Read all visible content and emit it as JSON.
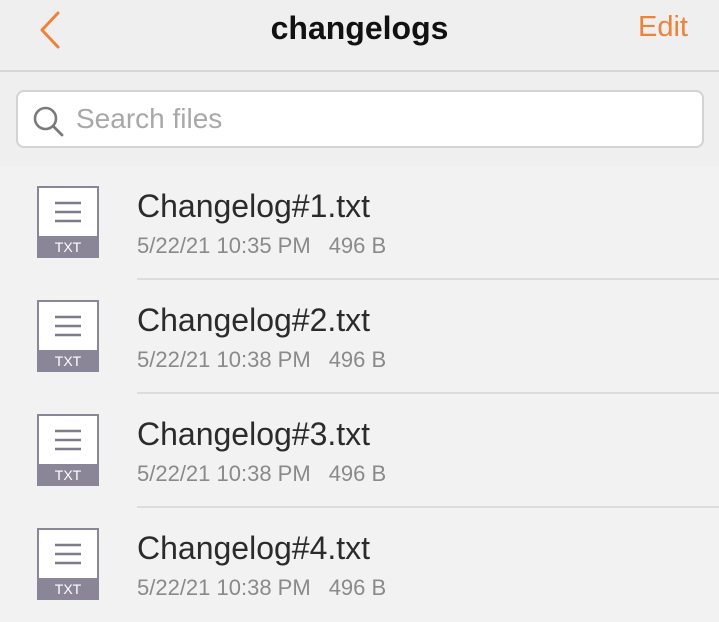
{
  "header": {
    "title": "changelogs",
    "edit_label": "Edit",
    "back_icon": "chevron-left-icon"
  },
  "search": {
    "placeholder": "Search files",
    "value": "",
    "icon": "search-icon"
  },
  "files": [
    {
      "name": "Changelog#1.txt",
      "date": "5/22/21 10:35 PM",
      "size": "496 B",
      "type_label": "TXT"
    },
    {
      "name": "Changelog#2.txt",
      "date": "5/22/21 10:38 PM",
      "size": "496 B",
      "type_label": "TXT"
    },
    {
      "name": "Changelog#3.txt",
      "date": "5/22/21 10:38 PM",
      "size": "496 B",
      "type_label": "TXT"
    },
    {
      "name": "Changelog#4.txt",
      "date": "5/22/21 10:38 PM",
      "size": "496 B",
      "type_label": "TXT"
    }
  ],
  "colors": {
    "accent": "#ee8239",
    "file_icon_label_bg": "#8a8698"
  }
}
